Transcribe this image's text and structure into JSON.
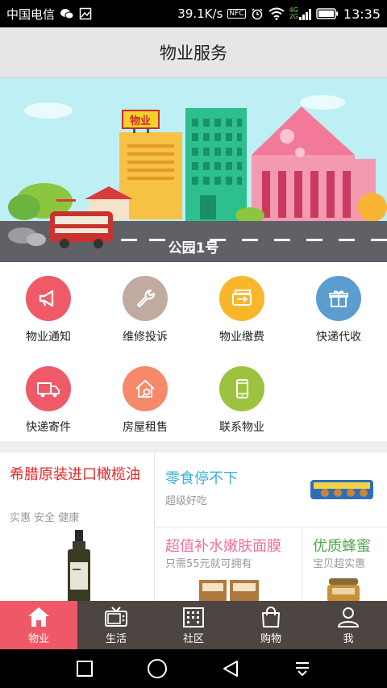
{
  "status_bar": {
    "carrier": "中国电信",
    "speed": "39.1K/s",
    "nfc": "NFC",
    "network": "4G",
    "network2": "2G",
    "time": "13:35"
  },
  "header": {
    "title": "物业服务"
  },
  "banner": {
    "caption": "公园1号",
    "sign": "物业"
  },
  "services": [
    {
      "label": "物业通知",
      "color": "#ee5a67",
      "icon": "megaphone-icon"
    },
    {
      "label": "维修投诉",
      "color": "#c1aba1",
      "icon": "wrench-icon"
    },
    {
      "label": "物业缴费",
      "color": "#f8b72b",
      "icon": "payment-icon"
    },
    {
      "label": "快递代收",
      "color": "#5b9dcf",
      "icon": "gift-icon"
    },
    {
      "label": "快递寄件",
      "color": "#ee5a67",
      "icon": "truck-icon"
    },
    {
      "label": "房屋租售",
      "color": "#f6896a",
      "icon": "house-icon"
    },
    {
      "label": "联系物业",
      "color": "#9cc33f",
      "icon": "phone-icon"
    }
  ],
  "promos": {
    "left": {
      "title": "希腊原装进口橄榄油",
      "subtitle": "实惠 安全  健康"
    },
    "top_right": {
      "title": "零食停不下",
      "subtitle": "超级好吃"
    },
    "mid": {
      "title": "超值补水嫩肤面膜",
      "subtitle": "只需55元就可拥有"
    },
    "right": {
      "title": "优质蜂蜜",
      "subtitle": "宝贝超实惠"
    }
  },
  "tabs": [
    {
      "label": "物业",
      "icon": "home-icon",
      "active": true
    },
    {
      "label": "生活",
      "icon": "tv-icon",
      "active": false
    },
    {
      "label": "社区",
      "icon": "building-icon",
      "active": false
    },
    {
      "label": "购物",
      "icon": "shopping-bag-icon",
      "active": false
    },
    {
      "label": "我",
      "icon": "user-icon",
      "active": false
    }
  ]
}
